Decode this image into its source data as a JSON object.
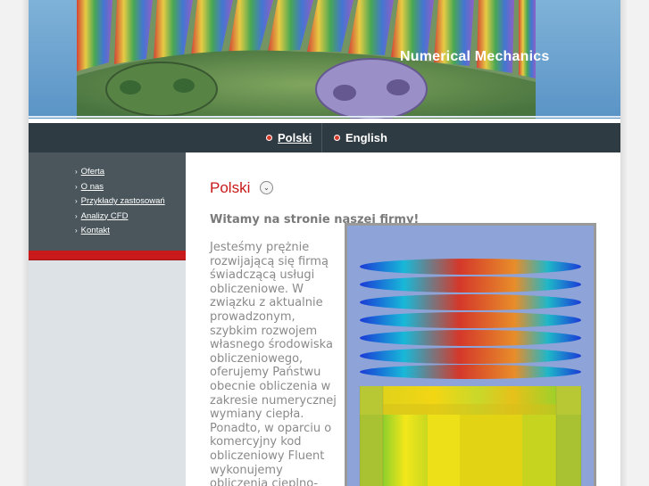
{
  "header": {
    "site_title": "Numerical Mechanics",
    "banner_image": "gear-mesh-image"
  },
  "language_bar": {
    "items": [
      {
        "label": "Polski",
        "active": true
      },
      {
        "label": "English",
        "active": false
      }
    ]
  },
  "sidebar": {
    "items": [
      {
        "label": "Oferta"
      },
      {
        "label": "O nas"
      },
      {
        "label": "Przykłady zastosowań"
      },
      {
        "label": "Analizy CFD"
      },
      {
        "label": "Kontakt"
      }
    ]
  },
  "content": {
    "title": "Polski",
    "welcome": "Witamy na stronie naszej firmy!",
    "paragraph": "Jesteśmy prężnie rozwijającą się firmą świadczącą usługi obliczeniowe. W związku z aktualnie prowadzonym, szybkim rozwojem własnego środowiska obliczeniowego, oferujemy Państwu obecnie obliczenia w zakresie numerycznej wymiany ciepła. Ponadto, w oparciu o komercyjny kod obliczeniowy Fluent wykonujemy obliczenia cieplno-",
    "figure": "heat-sink-simulation-image"
  },
  "colors": {
    "accent_red": "#c81a1a",
    "nav_dark": "#2f3b42",
    "sidebar_dark": "#4a565c"
  }
}
